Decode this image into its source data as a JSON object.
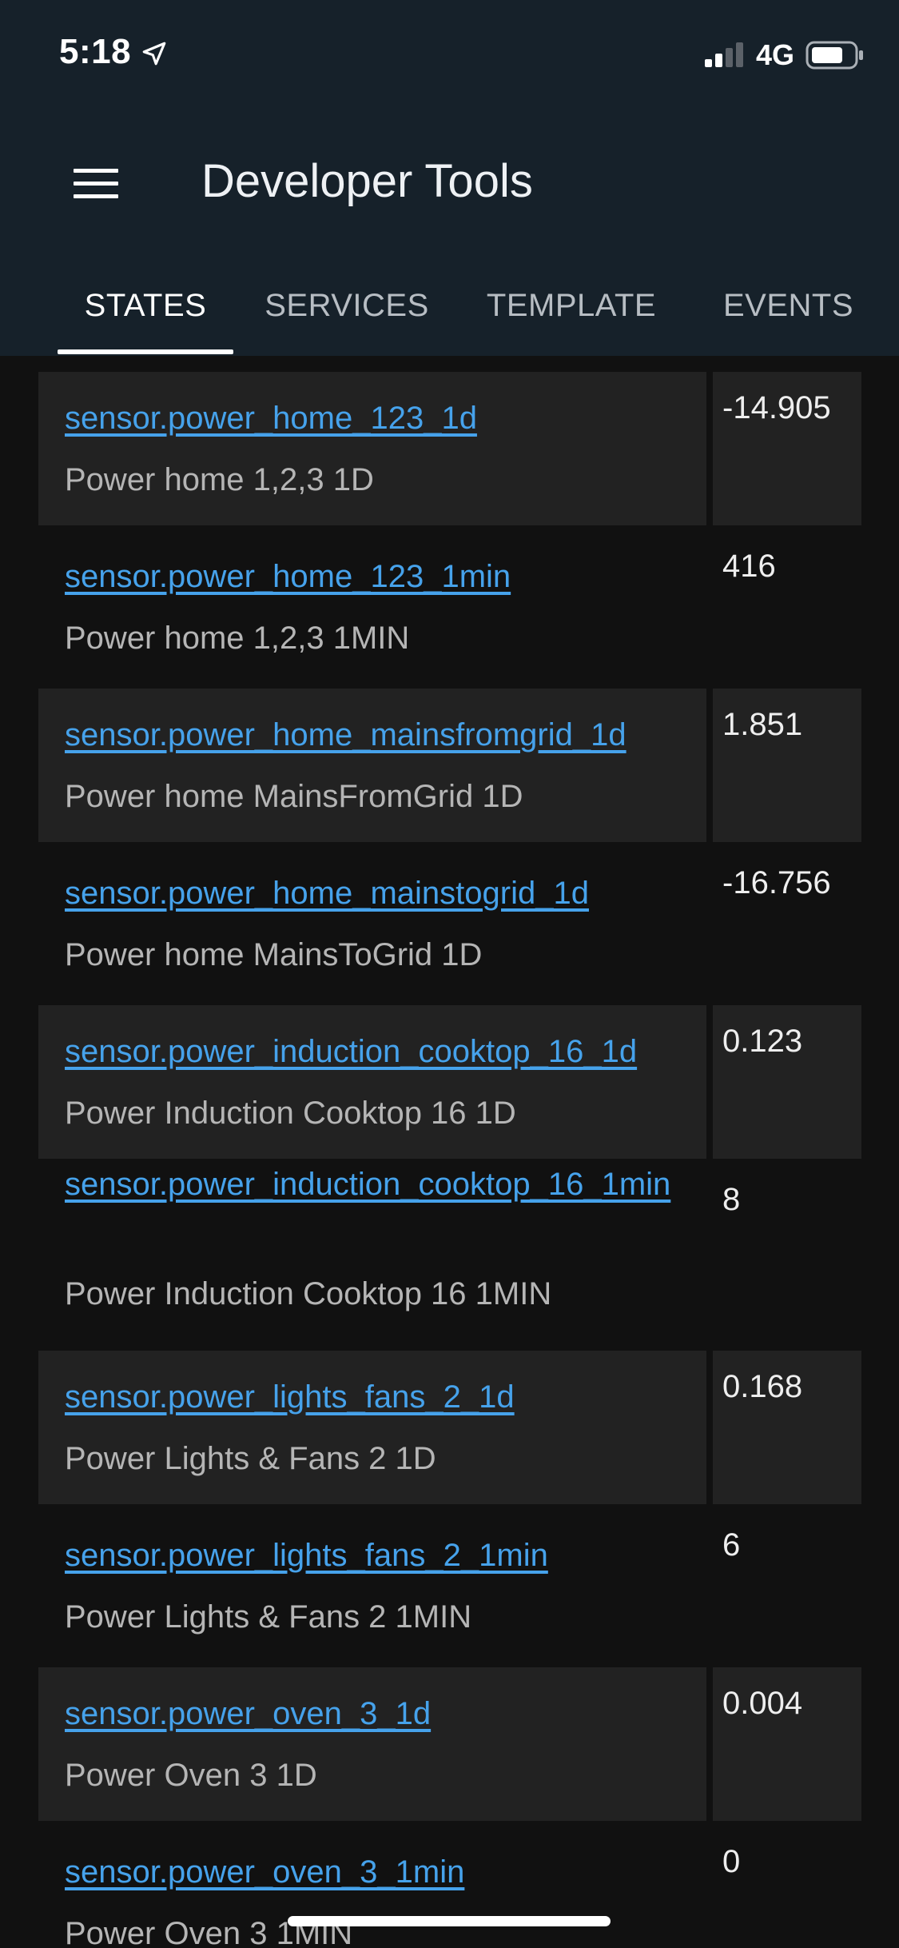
{
  "status_bar": {
    "time": "5:18",
    "network": "4G",
    "icons": [
      "location-arrow-icon",
      "cellular-signal-icon",
      "battery-icon"
    ]
  },
  "toolbar": {
    "title": "Developer Tools",
    "menu_icon": "hamburger-menu-icon"
  },
  "tabs": [
    {
      "label": "STATES",
      "active": true
    },
    {
      "label": "SERVICES",
      "active": false
    },
    {
      "label": "TEMPLATE",
      "active": false
    },
    {
      "label": "EVENTS",
      "active": false
    }
  ],
  "entities": [
    {
      "entity_id": "sensor.power_home_123_1d",
      "name": "Power home 1,2,3 1D",
      "state": "-14.905"
    },
    {
      "entity_id": "sensor.power_home_123_1min",
      "name": "Power home 1,2,3 1MIN",
      "state": "416"
    },
    {
      "entity_id": "sensor.power_home_mainsfromgrid_1d",
      "name": "Power home MainsFromGrid 1D",
      "state": "1.851"
    },
    {
      "entity_id": "sensor.power_home_mainstogrid_1d",
      "name": "Power home MainsToGrid 1D",
      "state": "-16.756"
    },
    {
      "entity_id": "sensor.power_induction_cooktop_16_1d",
      "name": "Power Induction Cooktop 16 1D",
      "state": "0.123"
    },
    {
      "entity_id": "sensor.power_induction_cooktop_16_1min",
      "name": "Power Induction Cooktop 16 1MIN",
      "state": "8"
    },
    {
      "entity_id": "sensor.power_lights_fans_2_1d",
      "name": "Power Lights & Fans 2 1D",
      "state": "0.168"
    },
    {
      "entity_id": "sensor.power_lights_fans_2_1min",
      "name": "Power Lights & Fans 2 1MIN",
      "state": "6"
    },
    {
      "entity_id": "sensor.power_oven_3_1d",
      "name": "Power Oven 3 1D",
      "state": "0.004"
    },
    {
      "entity_id": "sensor.power_oven_3_1min",
      "name": "Power Oven 3 1MIN",
      "state": "0"
    }
  ],
  "colors": {
    "header_bg": "#16212a",
    "page_bg": "#111111",
    "row_shade": "#222222",
    "link": "#46a2eb",
    "secondary_text": "#b5b5b5"
  }
}
